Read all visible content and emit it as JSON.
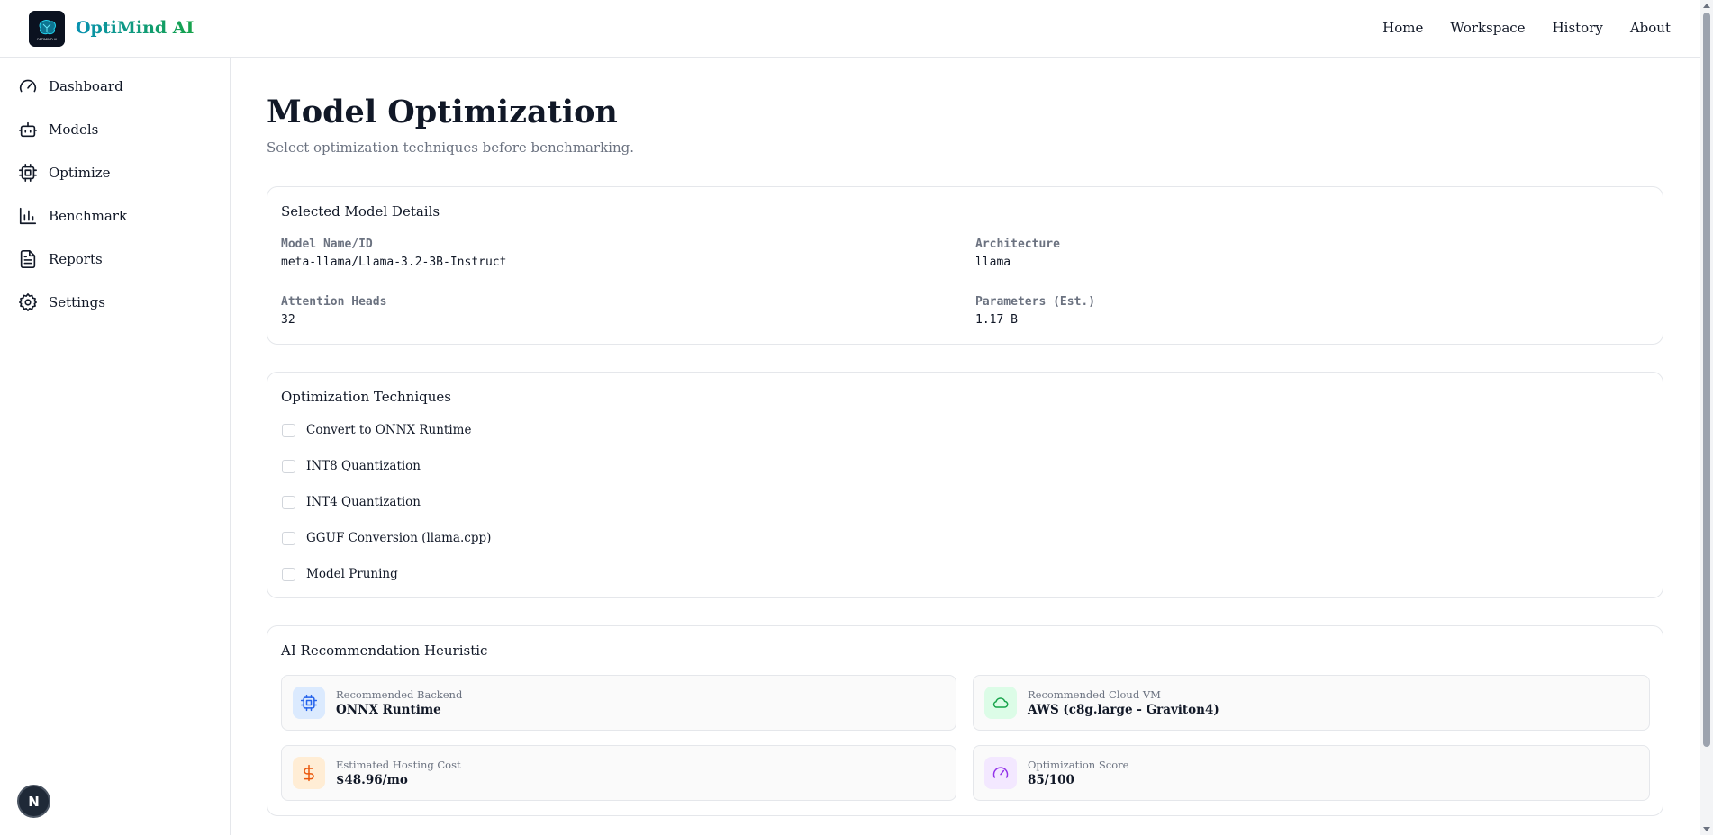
{
  "header": {
    "brand": "OptiMind AI",
    "logo_text": "OPTIMIND AI",
    "nav": [
      {
        "label": "Home"
      },
      {
        "label": "Workspace"
      },
      {
        "label": "History"
      },
      {
        "label": "About"
      }
    ]
  },
  "sidebar": {
    "items": [
      {
        "label": "Dashboard",
        "icon": "gauge-icon"
      },
      {
        "label": "Models",
        "icon": "bot-icon"
      },
      {
        "label": "Optimize",
        "icon": "cpu-icon"
      },
      {
        "label": "Benchmark",
        "icon": "bar-chart-icon"
      },
      {
        "label": "Reports",
        "icon": "file-text-icon"
      },
      {
        "label": "Settings",
        "icon": "gear-icon"
      }
    ],
    "badge": "N"
  },
  "main": {
    "title": "Model Optimization",
    "subtitle": "Select optimization techniques before benchmarking.",
    "model_details": {
      "title": "Selected Model Details",
      "fields": [
        {
          "label": "Model Name/ID",
          "value": "meta-llama/Llama-3.2-3B-Instruct"
        },
        {
          "label": "Architecture",
          "value": "llama"
        },
        {
          "label": "Attention Heads",
          "value": "32"
        },
        {
          "label": "Parameters (Est.)",
          "value": "1.17 B"
        }
      ]
    },
    "techniques": {
      "title": "Optimization Techniques",
      "options": [
        {
          "label": "Convert to ONNX Runtime",
          "checked": false
        },
        {
          "label": "INT8 Quantization",
          "checked": false
        },
        {
          "label": "INT4 Quantization",
          "checked": false
        },
        {
          "label": "GGUF Conversion (llama.cpp)",
          "checked": false
        },
        {
          "label": "Model Pruning",
          "checked": false
        }
      ]
    },
    "recommendation": {
      "title": "AI Recommendation Heuristic",
      "tiles": [
        {
          "label": "Recommended Backend",
          "value": "ONNX Runtime",
          "icon": "cpu-icon",
          "color": "#2563eb",
          "bg": "#dbeafe"
        },
        {
          "label": "Recommended Cloud VM",
          "value": "AWS (c8g.large - Graviton4)",
          "icon": "cloud-icon",
          "color": "#16a34a",
          "bg": "#dcfce7"
        },
        {
          "label": "Estimated Hosting Cost",
          "value": "$48.96/mo",
          "icon": "dollar-icon",
          "color": "#ea580c",
          "bg": "#ffedd5"
        },
        {
          "label": "Optimization Score",
          "value": "85/100",
          "icon": "gauge-icon",
          "color": "#9333ea",
          "bg": "#f3e8ff"
        }
      ]
    }
  }
}
